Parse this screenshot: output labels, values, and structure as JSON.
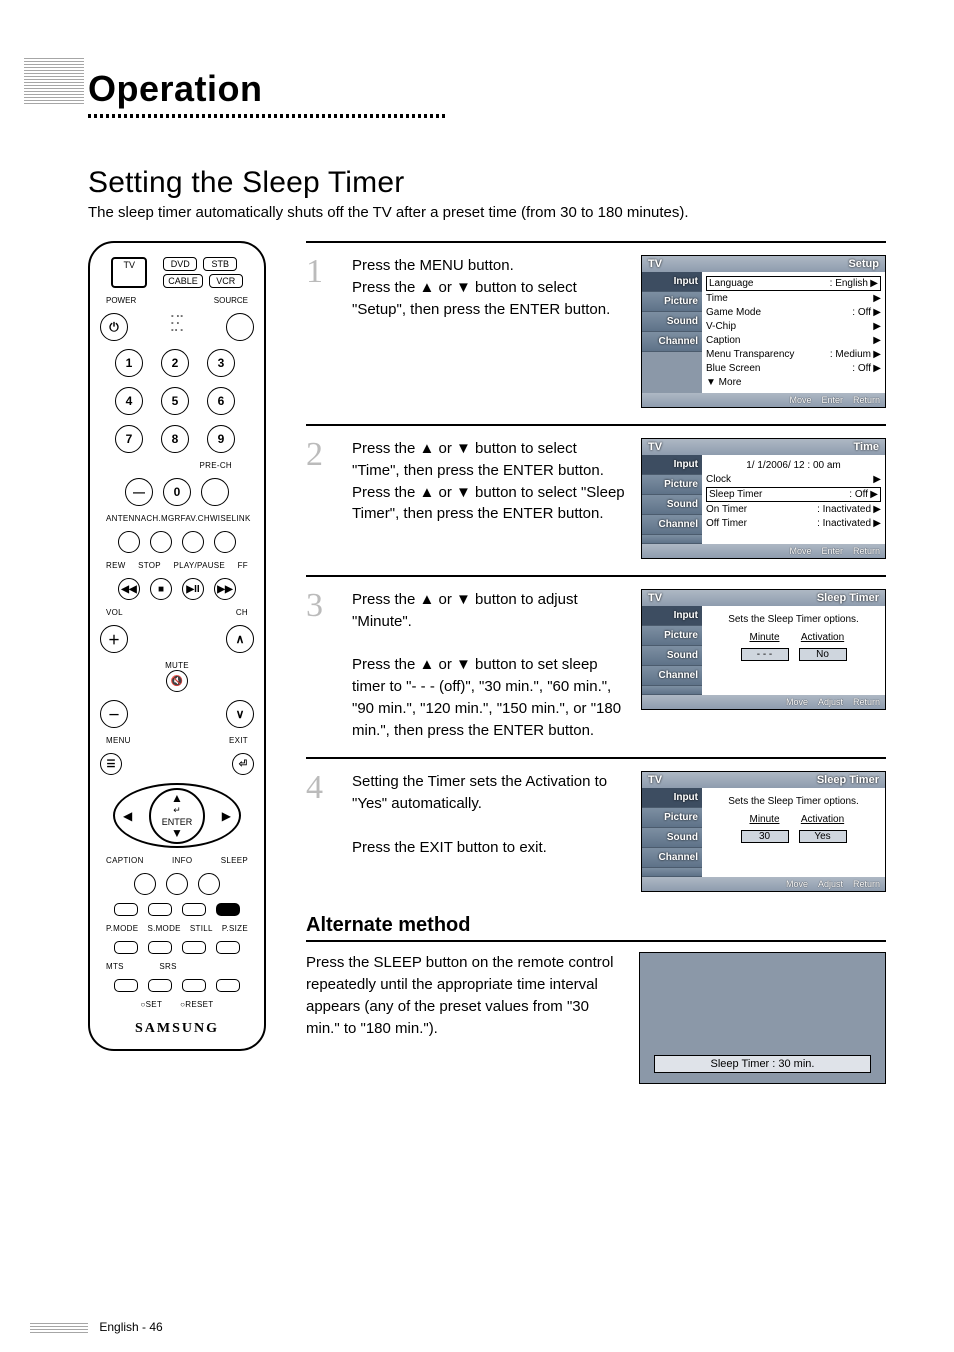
{
  "header": {
    "section": "Operation"
  },
  "title": "Setting the Sleep Timer",
  "intro": "The sleep timer automatically shuts off the TV after a preset time (from 30 to 180 minutes).",
  "remote": {
    "top_keys": {
      "tv": "TV",
      "dvd": "DVD",
      "stb": "STB",
      "cable": "CABLE",
      "vcr": "VCR"
    },
    "labels": {
      "power": "POWER",
      "source": "SOURCE",
      "prech": "PRE-CH",
      "antenna": "ANTENNA",
      "chmgr": "CH.MGR",
      "favch": "FAV.CH",
      "wiselink": "WISELINK",
      "rew": "REW",
      "stop": "STOP",
      "playpause": "PLAY/PAUSE",
      "ff": "FF",
      "vol": "VOL",
      "ch": "CH",
      "mute": "MUTE",
      "menu": "MENU",
      "exit": "EXIT",
      "enter": "ENTER",
      "caption": "CAPTION",
      "info": "INFO",
      "sleep": "SLEEP",
      "pmode": "P.MODE",
      "smode": "S.MODE",
      "still": "STILL",
      "psize": "P.SIZE",
      "mts": "MTS",
      "srs": "SRS",
      "set": "SET",
      "reset": "RESET"
    },
    "digits": [
      "1",
      "2",
      "3",
      "4",
      "5",
      "6",
      "7",
      "8",
      "9",
      "0"
    ],
    "brand": "SAMSUNG"
  },
  "steps": [
    {
      "num": "1",
      "text": "Press the MENU button.\nPress the ▲ or ▼ button to select \"Setup\", then press the ENTER button.",
      "osd": {
        "title_left": "TV",
        "title_right": "Setup",
        "tabs": [
          "Input",
          "Picture",
          "Sound",
          "Channel"
        ],
        "rows": [
          {
            "k": "Language",
            "v": ": English",
            "chev": "▶",
            "boxed": true
          },
          {
            "k": "Time",
            "v": "",
            "chev": "▶"
          },
          {
            "k": "Game Mode",
            "v": ": Off",
            "chev": "▶"
          },
          {
            "k": "V-Chip",
            "v": "",
            "chev": "▶"
          },
          {
            "k": "Caption",
            "v": "",
            "chev": "▶"
          },
          {
            "k": "Menu Transparency",
            "v": ": Medium",
            "chev": "▶"
          },
          {
            "k": "Blue Screen",
            "v": ": Off",
            "chev": "▶"
          },
          {
            "k": "▼ More",
            "v": "",
            "chev": ""
          }
        ],
        "footer": [
          "Move",
          "Enter",
          "Return"
        ]
      }
    },
    {
      "num": "2",
      "text": "Press the ▲ or ▼ button to select \"Time\", then press the ENTER button.\nPress the ▲ or ▼ button to select \"Sleep Timer\", then press the ENTER button.",
      "osd": {
        "title_left": "TV",
        "title_right": "Time",
        "tabs": [
          "Input",
          "Picture",
          "Sound",
          "Channel",
          ""
        ],
        "rows": [
          {
            "k": "",
            "v": "1/  1/2006/ 12 : 00 am",
            "chev": "",
            "center": true
          },
          {
            "k": "Clock",
            "v": "",
            "chev": "▶"
          },
          {
            "k": "Sleep Timer",
            "v": ": Off",
            "chev": "▶",
            "boxed": true
          },
          {
            "k": "On Timer",
            "v": ": Inactivated",
            "chev": "▶"
          },
          {
            "k": "Off Timer",
            "v": ": Inactivated",
            "chev": "▶"
          }
        ],
        "footer": [
          "Move",
          "Enter",
          "Return"
        ]
      }
    },
    {
      "num": "3",
      "text": "Press the ▲ or ▼ button to adjust \"Minute\".\n\nPress the ▲ or ▼ button to set sleep timer to \"- - - (off)\", \"30 min.\", \"60 min.\", \"90 min.\", \"120 min.\", \"150 min.\", or \"180 min.\", then press the ENTER button.",
      "osd": {
        "title_left": "TV",
        "title_right": "Sleep Timer",
        "tabs": [
          "Input",
          "Picture",
          "Sound",
          "Channel",
          ""
        ],
        "message": "Sets the Sleep Timer options.",
        "fields": {
          "hdr1": "Minute",
          "hdr2": "Activation",
          "val1": "- - -",
          "val2": "No"
        },
        "footer": [
          "Move",
          "Adjust",
          "Return"
        ]
      }
    },
    {
      "num": "4",
      "text": "Setting the Timer sets the Activation to \"Yes\" automatically.\n\nPress the EXIT button to exit.",
      "osd": {
        "title_left": "TV",
        "title_right": "Sleep Timer",
        "tabs": [
          "Input",
          "Picture",
          "Sound",
          "Channel",
          ""
        ],
        "message": "Sets the Sleep Timer options.",
        "fields": {
          "hdr1": "Minute",
          "hdr2": "Activation",
          "val1": "30",
          "val2": "Yes"
        },
        "footer": [
          "Move",
          "Adjust",
          "Return"
        ]
      }
    }
  ],
  "alternate": {
    "title": "Alternate method",
    "text": "Press the SLEEP button on the remote control repeatedly until the appropriate time interval appears (any of the preset values from \"30 min.\" to \"180 min.\").",
    "banner": "Sleep Timer : 30 min."
  },
  "footer": "English - 46"
}
